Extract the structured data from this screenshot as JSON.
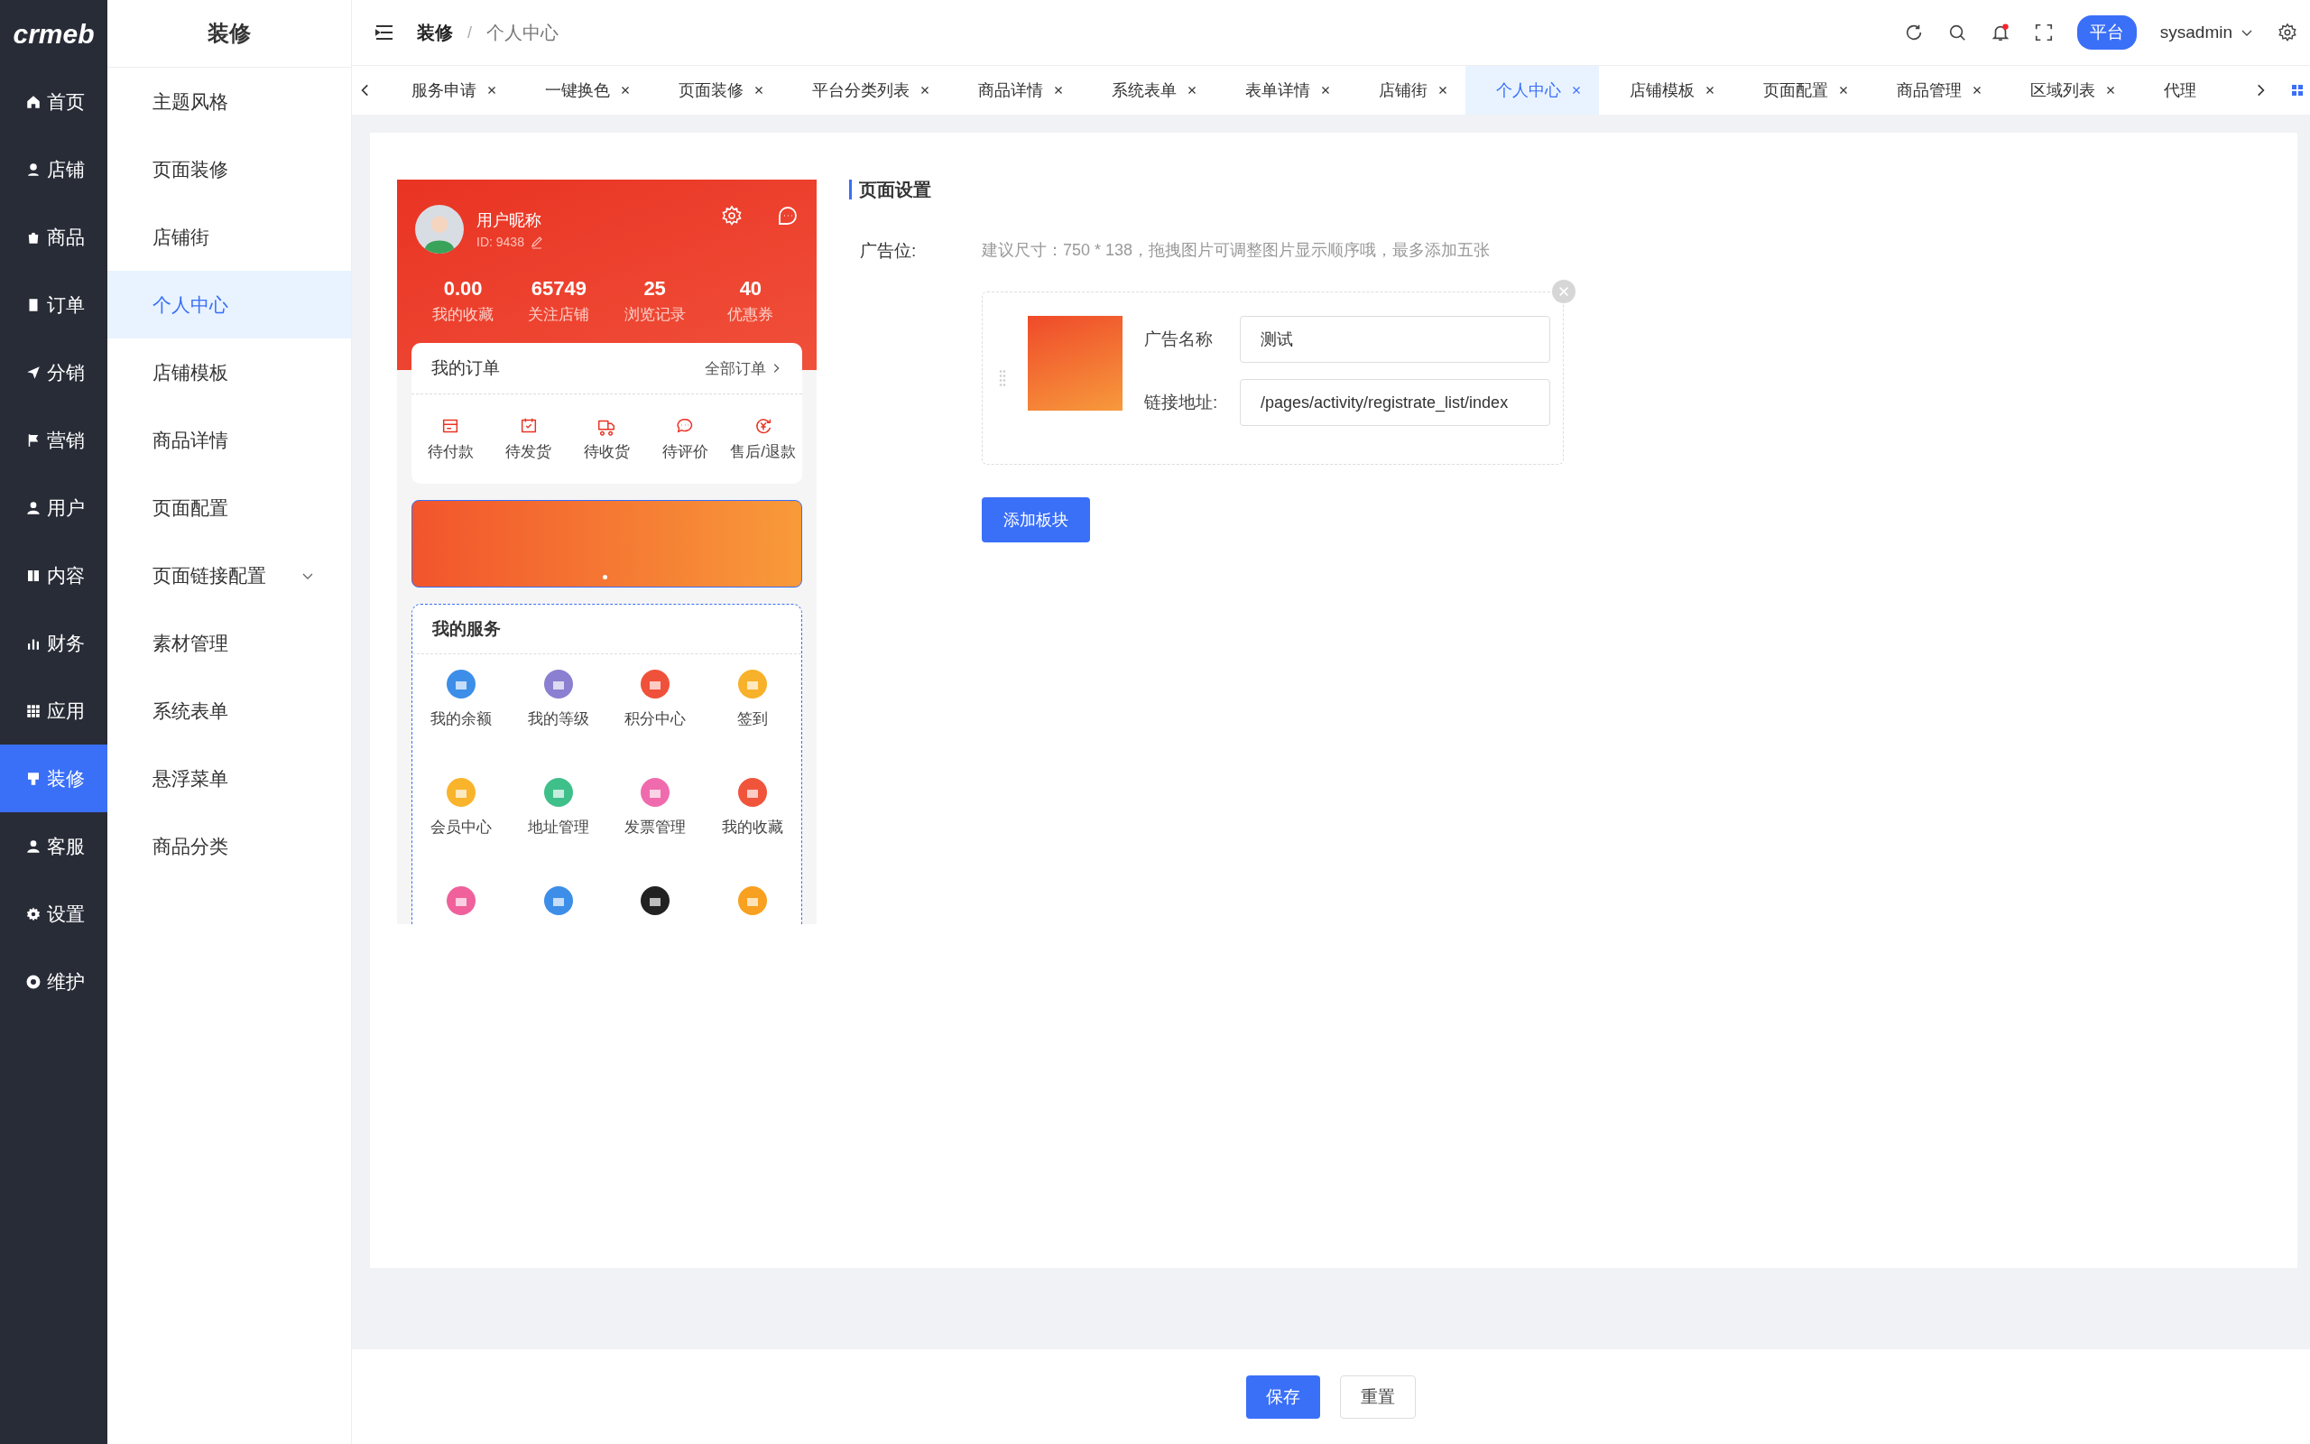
{
  "logo": "crmeb",
  "nav": [
    {
      "label": "首页",
      "selected": false
    },
    {
      "label": "店铺",
      "selected": false
    },
    {
      "label": "商品",
      "selected": false
    },
    {
      "label": "订单",
      "selected": false
    },
    {
      "label": "分销",
      "selected": false
    },
    {
      "label": "营销",
      "selected": false
    },
    {
      "label": "用户",
      "selected": false
    },
    {
      "label": "内容",
      "selected": false
    },
    {
      "label": "财务",
      "selected": false
    },
    {
      "label": "应用",
      "selected": false
    },
    {
      "label": "装修",
      "selected": true
    },
    {
      "label": "客服",
      "selected": false
    },
    {
      "label": "设置",
      "selected": false
    },
    {
      "label": "维护",
      "selected": false
    }
  ],
  "submenu": {
    "title": "装修",
    "items": [
      {
        "label": "主题风格",
        "selected": false,
        "expandable": false
      },
      {
        "label": "页面装修",
        "selected": false,
        "expandable": false
      },
      {
        "label": "店铺街",
        "selected": false,
        "expandable": false
      },
      {
        "label": "个人中心",
        "selected": true,
        "expandable": false
      },
      {
        "label": "店铺模板",
        "selected": false,
        "expandable": false
      },
      {
        "label": "商品详情",
        "selected": false,
        "expandable": false
      },
      {
        "label": "页面配置",
        "selected": false,
        "expandable": false
      },
      {
        "label": "页面链接配置",
        "selected": false,
        "expandable": true
      },
      {
        "label": "素材管理",
        "selected": false,
        "expandable": false
      },
      {
        "label": "系统表单",
        "selected": false,
        "expandable": false
      },
      {
        "label": "悬浮菜单",
        "selected": false,
        "expandable": false
      },
      {
        "label": "商品分类",
        "selected": false,
        "expandable": false
      }
    ]
  },
  "breadcrumb": {
    "items": [
      "装修",
      "个人中心"
    ],
    "separator": "/"
  },
  "header": {
    "platform_button": "平台",
    "user": "sysadmin",
    "notification_dot": true
  },
  "tabs": [
    {
      "label": "服务申请",
      "selected": false,
      "closable": true
    },
    {
      "label": "一键换色",
      "selected": false,
      "closable": true
    },
    {
      "label": "页面装修",
      "selected": false,
      "closable": true
    },
    {
      "label": "平台分类列表",
      "selected": false,
      "closable": true
    },
    {
      "label": "商品详情",
      "selected": false,
      "closable": true
    },
    {
      "label": "系统表单",
      "selected": false,
      "closable": true
    },
    {
      "label": "表单详情",
      "selected": false,
      "closable": true
    },
    {
      "label": "店铺街",
      "selected": false,
      "closable": true
    },
    {
      "label": "个人中心",
      "selected": true,
      "closable": true
    },
    {
      "label": "店铺模板",
      "selected": false,
      "closable": true
    },
    {
      "label": "页面配置",
      "selected": false,
      "closable": true
    },
    {
      "label": "商品管理",
      "selected": false,
      "closable": true
    },
    {
      "label": "区域列表",
      "selected": false,
      "closable": true
    },
    {
      "label": "代理",
      "selected": false,
      "closable": false
    }
  ],
  "preview": {
    "nickname": "用户昵称",
    "user_id": "ID: 9438",
    "stats": [
      {
        "value": "0.00",
        "label": "我的收藏"
      },
      {
        "value": "65749",
        "label": "关注店铺"
      },
      {
        "value": "25",
        "label": "浏览记录"
      },
      {
        "value": "40",
        "label": "优惠券"
      }
    ],
    "orders": {
      "title": "我的订单",
      "more": "全部订单",
      "items": [
        "待付款",
        "待发货",
        "待收货",
        "待评价",
        "售后/退款"
      ]
    },
    "services": {
      "title": "我的服务",
      "items": [
        {
          "label": "我的余额",
          "color": "#3d8ee8"
        },
        {
          "label": "我的等级",
          "color": "#8a7fd0"
        },
        {
          "label": "积分中心",
          "color": "#f0513a"
        },
        {
          "label": "签到",
          "color": "#f8b12a"
        },
        {
          "label": "会员中心",
          "color": "#f9b42c"
        },
        {
          "label": "地址管理",
          "color": "#3fbf8a"
        },
        {
          "label": "发票管理",
          "color": "#f06bae"
        },
        {
          "label": "我的收藏",
          "color": "#f0553c"
        },
        {
          "color": "#f0609a"
        },
        {
          "color": "#3d8ee8"
        },
        {
          "color": "#222222"
        },
        {
          "color": "#f8a020"
        }
      ]
    }
  },
  "settings": {
    "title": "页面设置",
    "ad_label": "广告位:",
    "hint": "建议尺寸：750 * 138，拖拽图片可调整图片显示顺序哦，最多添加五张",
    "ads": [
      {
        "name_label": "广告名称",
        "name": "测试",
        "link_label": "链接地址:",
        "link": "/pages/activity/registrate_list/index"
      }
    ],
    "add_button": "添加板块"
  },
  "footer": {
    "save": "保存",
    "reset": "重置"
  }
}
